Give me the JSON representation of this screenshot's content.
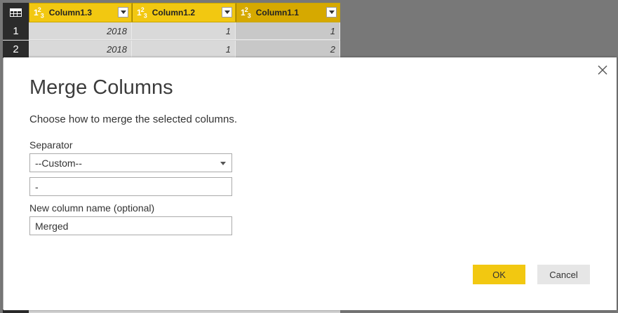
{
  "grid": {
    "columns": [
      {
        "type_icon": "number-type-icon",
        "name": "Column1.3"
      },
      {
        "type_icon": "number-type-icon",
        "name": "Column1.2"
      },
      {
        "type_icon": "number-type-icon",
        "name": "Column1.1"
      }
    ],
    "rows": [
      {
        "num": "1",
        "cells": [
          "2018",
          "1",
          "1"
        ]
      },
      {
        "num": "2",
        "cells": [
          "2018",
          "1",
          "2"
        ]
      }
    ],
    "type_label": {
      "a": "1",
      "b": "2",
      "c": "3"
    }
  },
  "dialog": {
    "title": "Merge Columns",
    "subtitle": "Choose how to merge the selected columns.",
    "separator_label": "Separator",
    "separator_value": "--Custom--",
    "custom_separator_value": "-",
    "new_column_label": "New column name (optional)",
    "new_column_value": "Merged",
    "ok_label": "OK",
    "cancel_label": "Cancel"
  },
  "colors": {
    "accent": "#F2C811",
    "header_selected": "#D6A900",
    "overlay": "#787878"
  }
}
